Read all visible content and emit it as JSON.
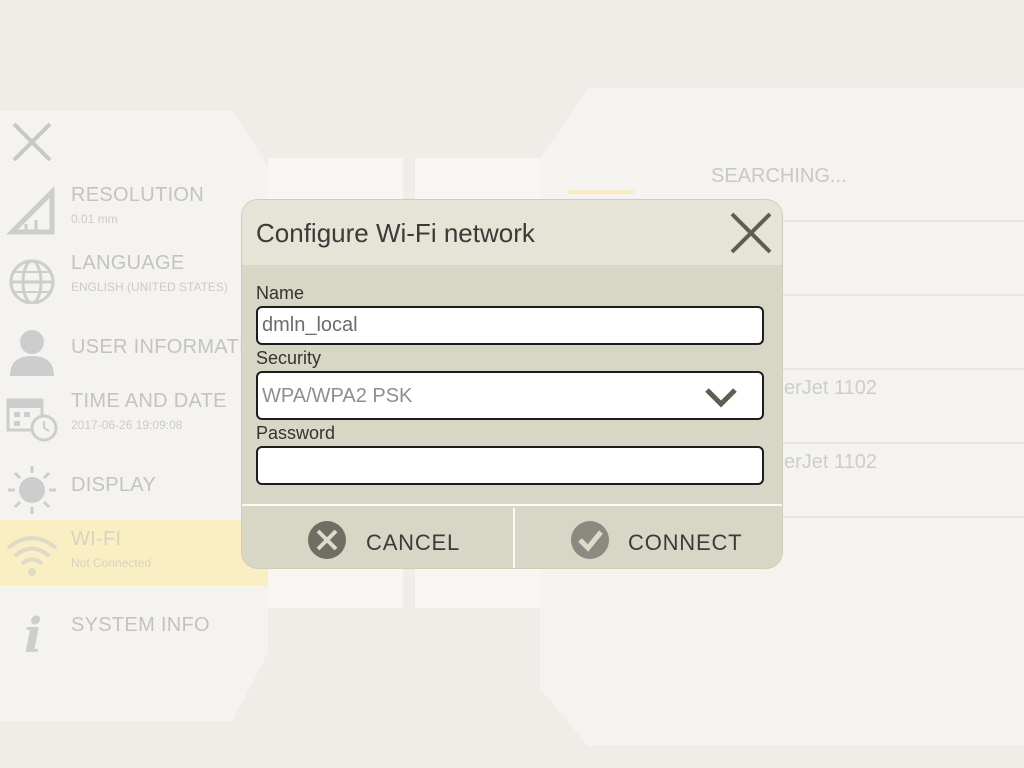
{
  "background": {
    "menu": {
      "items": [
        {
          "label": "RESOLUTION",
          "sub": "0.01 mm",
          "icon": "ruler-triangle-icon"
        },
        {
          "label": "LANGUAGE",
          "sub": "ENGLISH (UNITED STATES)",
          "icon": "globe-icon"
        },
        {
          "label": "USER INFORMATION",
          "sub": "",
          "icon": "user-icon"
        },
        {
          "label": "TIME AND DATE",
          "sub": "2017-06-26 19:09:08",
          "icon": "calendar-clock-icon"
        },
        {
          "label": "DISPLAY",
          "sub": "",
          "icon": "sun-icon"
        },
        {
          "label": "WI-FI",
          "sub": "Not Connected",
          "icon": "wifi-icon"
        },
        {
          "label": "SYSTEM INFO",
          "sub": "",
          "icon": "info-icon"
        }
      ]
    },
    "networks": {
      "status": "SEARCHING...",
      "items": [
        "erJet 1102",
        "erJet 1102"
      ]
    }
  },
  "dialog": {
    "title": "Configure Wi-Fi network",
    "name_label": "Name",
    "name_value": "dmln_local",
    "security_label": "Security",
    "security_value": "WPA/WPA2 PSK",
    "password_label": "Password",
    "password_value": "",
    "cancel_label": "CANCEL",
    "connect_label": "CONNECT"
  },
  "colors": {
    "dialog_bg": "#d8d6c4",
    "dialog_header": "#e6e4d6",
    "active_menu": "#faefc2",
    "icon_dark": "#6a6a5e"
  }
}
